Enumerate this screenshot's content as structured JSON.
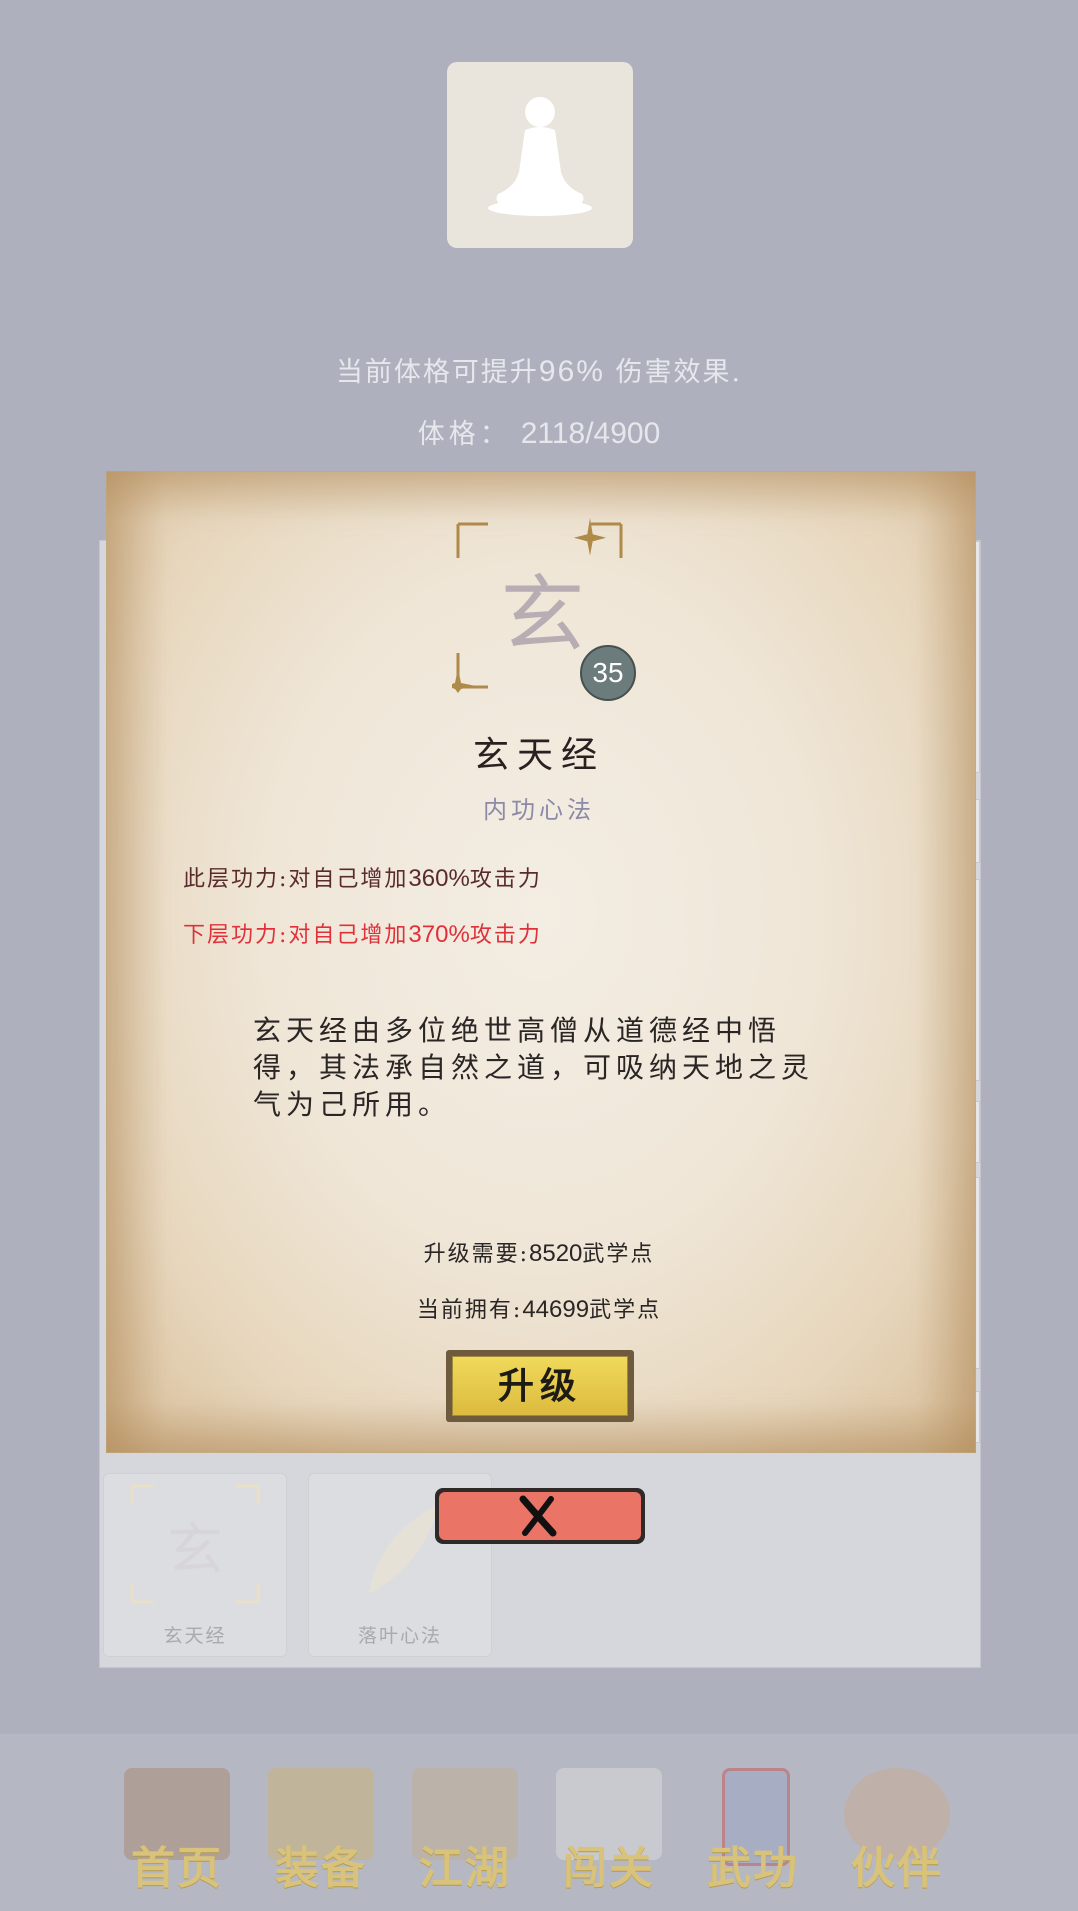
{
  "header": {
    "effect_prefix": "当前体格可提升",
    "effect_value": "96%",
    "effect_suffix": " 伤害效果.",
    "stat_label": "体格：",
    "stat_value": "2118/4900"
  },
  "skill_list": [
    {
      "name": "玄天经",
      "icon": "xuan-glyph-icon"
    },
    {
      "name": "落叶心法",
      "icon": "leaf-icon"
    }
  ],
  "dialog": {
    "icon_char": "玄",
    "level": "35",
    "title": "玄天经",
    "type": "内功心法",
    "current_effect": {
      "prefix": "此层功力:对自己增加",
      "value": "360%",
      "suffix": "攻击力"
    },
    "next_effect": {
      "prefix": "下层功力:对自己增加",
      "value": "370%",
      "suffix": "攻击力"
    },
    "description": "玄天经由多位绝世高僧从道德经中悟得，其法承自然之道，可吸纳天地之灵气为己所用。",
    "upgrade_cost": {
      "prefix": "升级需要:",
      "value": "8520",
      "suffix": "武学点"
    },
    "current_points": {
      "prefix": "当前拥有:",
      "value": "44699",
      "suffix": "武学点"
    },
    "upgrade_label": "升级",
    "close_icon": "close-x-icon"
  },
  "nav": [
    {
      "label": "首页",
      "icon": "home-icon"
    },
    {
      "label": "装备",
      "icon": "equipment-icon"
    },
    {
      "label": "江湖",
      "icon": "jianghu-icon"
    },
    {
      "label": "闯关",
      "icon": "stage-icon"
    },
    {
      "label": "武功",
      "icon": "martial-arts-icon"
    },
    {
      "label": "伙伴",
      "icon": "partners-icon"
    }
  ],
  "colors": {
    "background": "#aeb1bd",
    "next_effect": "#e0313a",
    "upgrade_button": "#e8cc4c",
    "close_button": "#ea7465"
  }
}
